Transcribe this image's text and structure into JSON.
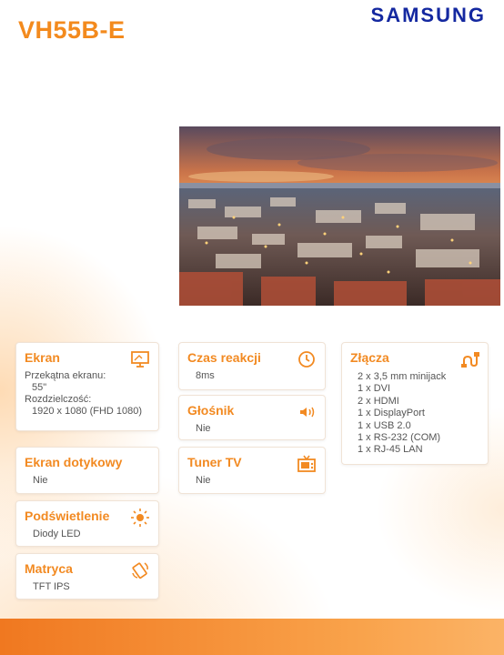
{
  "header": {
    "model": "VH55B-E",
    "brand": "SAMSUNG"
  },
  "cards": {
    "ekran": {
      "title": "Ekran",
      "icon": "monitor-icon",
      "diag_label": "Przekątna ekranu:",
      "diag_value": "55\"",
      "res_label": "Rozdzielczość:",
      "res_value": "1920 x 1080 (FHD 1080)"
    },
    "czas": {
      "title": "Czas reakcji",
      "icon": "clock-icon",
      "value": "8ms"
    },
    "glosnik": {
      "title": "Głośnik",
      "icon": "speaker-icon",
      "value": "Nie"
    },
    "tuner": {
      "title": "Tuner TV",
      "icon": "tv-icon",
      "value": "Nie"
    },
    "dotykowy": {
      "title": "Ekran dotykowy",
      "value": "Nie"
    },
    "podswietlenie": {
      "title": "Podświetlenie",
      "icon": "sun-icon",
      "value": "Diody LED"
    },
    "matryca": {
      "title": "Matryca",
      "icon": "rotate-panel-icon",
      "value": "TFT IPS"
    },
    "zlacza": {
      "title": "Złącza",
      "icon": "plug-cable-icon",
      "items": [
        "2 x 3,5 mm minijack",
        "1 x DVI",
        "2 x HDMI",
        "1 x DisplayPort",
        "1 x USB 2.0",
        "1 x RS-232 (COM)",
        "1 x RJ-45 LAN"
      ]
    }
  },
  "colors": {
    "accent": "#f28a22",
    "brand": "#1428a0",
    "footer": "#f07820"
  }
}
